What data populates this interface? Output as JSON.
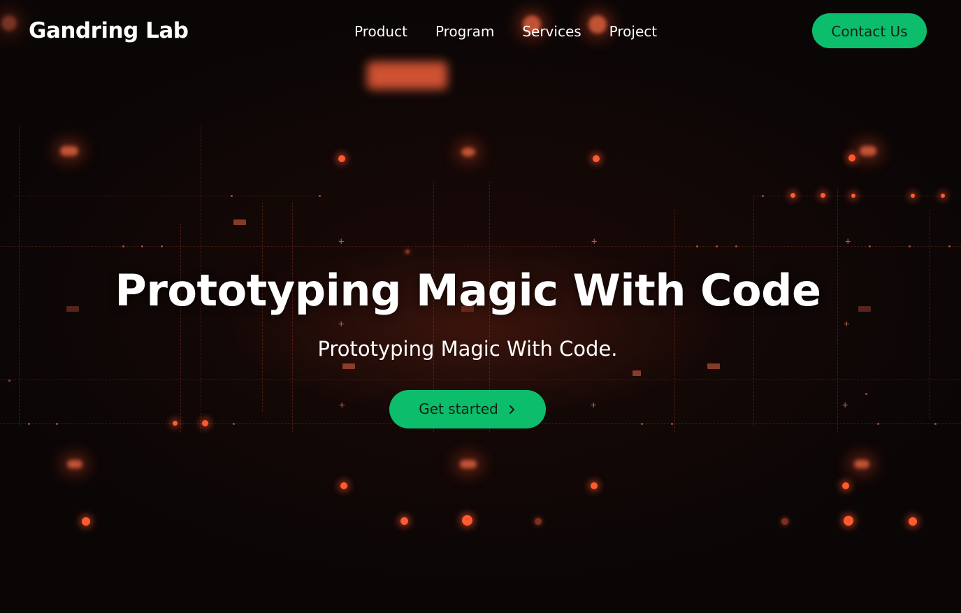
{
  "brand": {
    "name": "Gandring Lab"
  },
  "nav": {
    "items": [
      {
        "label": "Product"
      },
      {
        "label": "Program"
      },
      {
        "label": "Services"
      },
      {
        "label": "Project"
      }
    ],
    "contact_label": "Contact Us"
  },
  "hero": {
    "title": "Prototyping Magic With Code",
    "subtitle": "Prototyping Magic With Code.",
    "cta_label": "Get started",
    "cta_icon": "chevron-right-icon"
  },
  "colors": {
    "accent": "#0cbd6c",
    "accent_text": "#0f2416",
    "background": "#0b0606",
    "particle": "#ff5a30",
    "text": "#ffffff"
  }
}
